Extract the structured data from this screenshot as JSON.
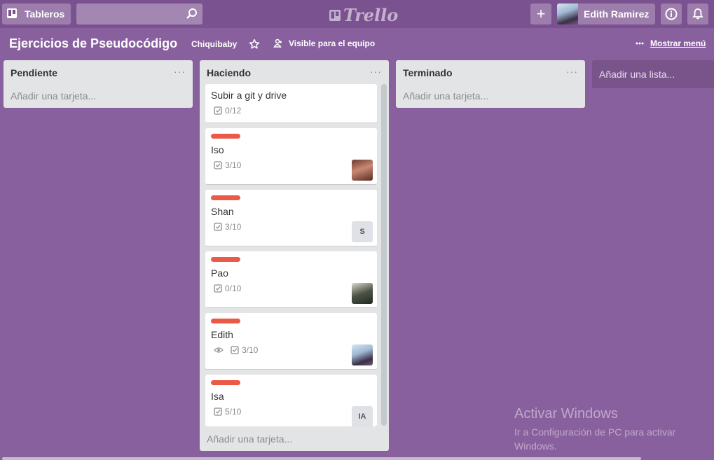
{
  "header": {
    "boards_label": "Tableros",
    "search_placeholder": "",
    "logo_text": "Trello",
    "add_label": "+",
    "user_name": "Edith Ramirez"
  },
  "board": {
    "title": "Ejercicios de Pseudocódigo",
    "team": "Chiquibaby",
    "visibility": "Visible para el equipo",
    "show_menu": "Mostrar menú"
  },
  "lists": [
    {
      "title": "Pendiente",
      "add_card": "Añadir una tarjeta..."
    },
    {
      "title": "Haciendo",
      "add_card": "Añadir una tarjeta...",
      "cards": [
        {
          "title": "Subir a git y drive",
          "checklist": "0/12"
        },
        {
          "title": "Iso",
          "label_color": "#eb5a46",
          "checklist": "3/10",
          "member": "avatar"
        },
        {
          "title": "Shan",
          "label_color": "#eb5a46",
          "checklist": "3/10",
          "member_initials": "S"
        },
        {
          "title": "Pao",
          "label_color": "#eb5a46",
          "checklist": "0/10",
          "member": "avatar"
        },
        {
          "title": "Edith",
          "label_color": "#eb5a46",
          "watching": "eye-icon",
          "checklist": "3/10",
          "member": "avatar"
        },
        {
          "title": "Isa",
          "label_color": "#eb5a46",
          "checklist": "5/10",
          "member_initials": "IA"
        }
      ]
    },
    {
      "title": "Terminado",
      "add_card": "Añadir una tarjeta..."
    }
  ],
  "add_list": "Añadir una lista...",
  "watermark": {
    "line1": "Activar Windows",
    "line2": "Ir a Configuración de PC para activar Windows."
  },
  "colors": {
    "board_bg": "#89609e",
    "header_bg": "#7b5290",
    "label_red": "#eb5a46",
    "list_bg": "#e2e4e6"
  }
}
